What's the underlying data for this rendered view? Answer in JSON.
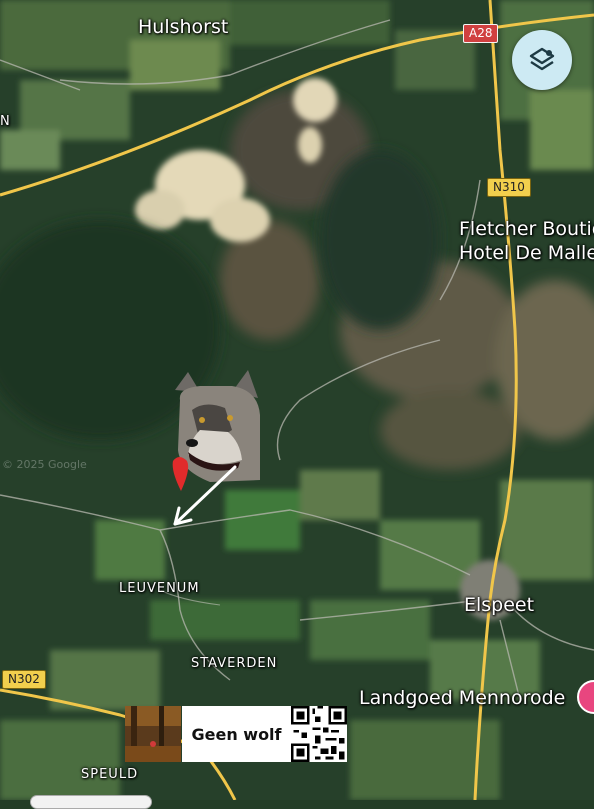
{
  "map": {
    "labels": {
      "hulshorst": "Hulshorst",
      "n_partial": "N",
      "leuvenum": "LEUVENUM",
      "elspeet": "Elspeet",
      "staverden": "STAVERDEN",
      "speuld": "SPEULD",
      "hotel_line1": "Fletcher Boutiq",
      "hotel_line2": "Hotel De Malle",
      "landgoed": "Landgoed Mennorode"
    },
    "road_shields": {
      "a28": "A28",
      "n310": "N310",
      "n302": "N302"
    },
    "watermark": "© 2025 Google",
    "colors": {
      "forest": "#26402a",
      "road": "#f0c64a",
      "sand": "#e4d9b8",
      "shield_red": "#d04040",
      "shield_yellow": "#f2cf4d"
    }
  },
  "controls": {
    "layers_icon": "layers-icon"
  },
  "overlay": {
    "sticker_text": "Geen wolf",
    "wolf_icon": "wolf-head-image",
    "arrow_icon": "arrow-icon"
  }
}
